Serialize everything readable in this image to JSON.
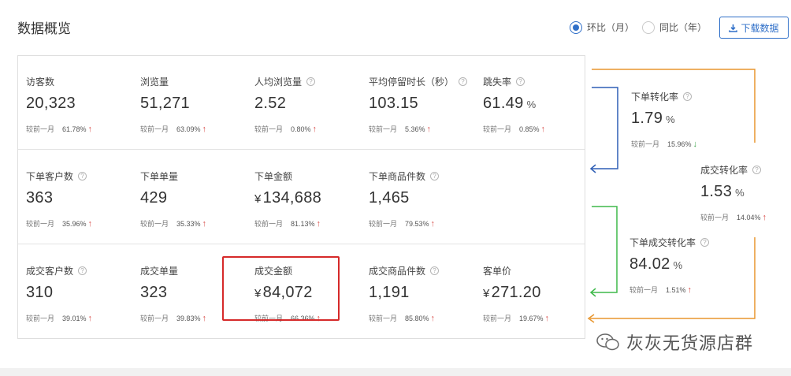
{
  "header": {
    "title": "数据概览",
    "radio_options": [
      {
        "label": "环比（月）",
        "checked": true
      },
      {
        "label": "同比（年）",
        "checked": false
      }
    ],
    "download_label": "下载数据"
  },
  "compare_prefix": "较前一月",
  "metrics": {
    "visitors": {
      "label": "访客数",
      "value": "20,323",
      "change": "61.78%",
      "trend": "up"
    },
    "pageviews": {
      "label": "浏览量",
      "value": "51,271",
      "change": "63.09%",
      "trend": "up"
    },
    "avg_views": {
      "label": "人均浏览量",
      "value": "2.52",
      "change": "0.80%",
      "trend": "up"
    },
    "avg_stay": {
      "label": "平均停留时长（秒）",
      "value": "103.15",
      "change": "5.36%",
      "trend": "up"
    },
    "bounce": {
      "label": "跳失率",
      "value": "61.49",
      "unit": "%",
      "change": "0.85%",
      "trend": "up"
    },
    "order_customers": {
      "label": "下单客户数",
      "value": "363",
      "change": "35.96%",
      "trend": "up"
    },
    "order_count": {
      "label": "下单单量",
      "value": "429",
      "change": "35.33%",
      "trend": "up"
    },
    "order_amount": {
      "label": "下单金额",
      "prefix": "¥",
      "value": "134,688",
      "change": "81.13%",
      "trend": "up"
    },
    "order_items": {
      "label": "下单商品件数",
      "value": "1,465",
      "change": "79.53%",
      "trend": "up"
    },
    "deal_customers": {
      "label": "成交客户数",
      "value": "310",
      "change": "39.01%",
      "trend": "up"
    },
    "deal_count": {
      "label": "成交单量",
      "value": "323",
      "change": "39.83%",
      "trend": "up"
    },
    "deal_amount": {
      "label": "成交金额",
      "prefix": "¥",
      "value": "84,072",
      "change": "66.36%",
      "trend": "up"
    },
    "deal_items": {
      "label": "成交商品件数",
      "value": "1,191",
      "change": "85.80%",
      "trend": "up"
    },
    "unit_price": {
      "label": "客单价",
      "prefix": "¥",
      "value": "271.20",
      "change": "19.67%",
      "trend": "up"
    }
  },
  "conversion": {
    "order_rate": {
      "label": "下单转化率",
      "value": "1.79",
      "unit": "%",
      "change": "15.96%",
      "trend": "down"
    },
    "deal_rate": {
      "label": "成交转化率",
      "value": "1.53",
      "unit": "%",
      "change": "14.04%",
      "trend": "up"
    },
    "order_deal_rate": {
      "label": "下单成交转化率",
      "value": "84.02",
      "unit": "%",
      "change": "1.51%",
      "trend": "up"
    }
  },
  "watermark": "灰灰无货源店群",
  "colors": {
    "accent": "#2f6fc8",
    "up": "#d9534f",
    "down": "#3aa34a",
    "flow_orange": "#e8962e",
    "flow_blue": "#2f5fb5",
    "flow_green": "#3fb94a",
    "highlight": "#d62a2a"
  }
}
